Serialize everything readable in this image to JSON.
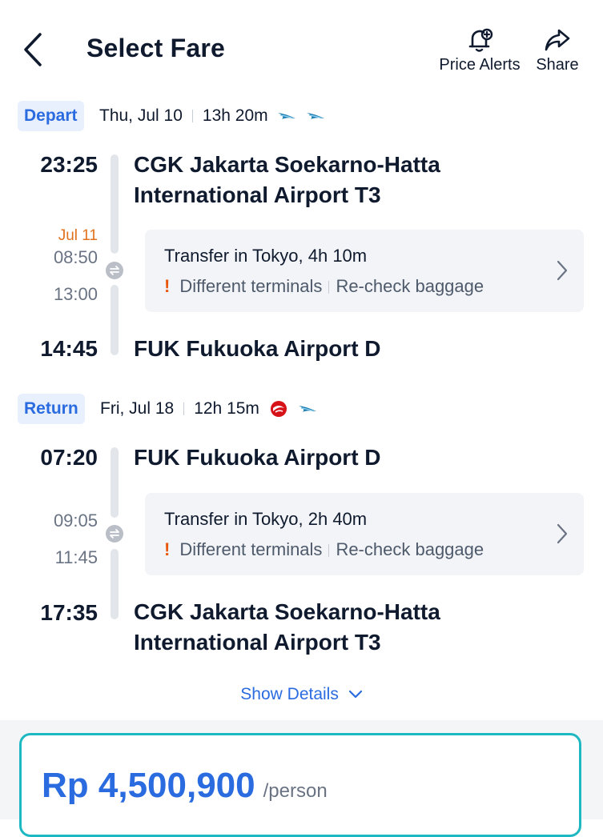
{
  "header": {
    "title": "Select Fare",
    "back_icon": "chevron-left-icon",
    "price_alerts_label": "Price Alerts",
    "share_label": "Share"
  },
  "depart": {
    "tag": "Depart",
    "date": "Thu, Jul 10",
    "duration": "13h 20m",
    "airlines": [
      "garuda-logo-icon",
      "garuda-logo-icon"
    ],
    "departure_time": "23:25",
    "departure_airport_line1": "CGK Jakarta Soekarno-Hatta",
    "departure_airport_line2": "International Airport T3",
    "transfer_date_note": "Jul 11",
    "transfer_arrive_time": "08:50",
    "transfer_depart_time": "13:00",
    "transfer_title": "Transfer in Tokyo, 4h 10m",
    "transfer_note1": "Different terminals",
    "transfer_note2": "Re-check baggage",
    "arrival_time": "14:45",
    "arrival_airport": "FUK Fukuoka Airport D"
  },
  "return": {
    "tag": "Return",
    "date": "Fri, Jul 18",
    "duration": "12h 15m",
    "airlines": [
      "jal-logo-icon",
      "garuda-logo-icon"
    ],
    "departure_time": "07:20",
    "departure_airport": "FUK Fukuoka Airport D",
    "transfer_arrive_time": "09:05",
    "transfer_depart_time": "11:45",
    "transfer_title": "Transfer in Tokyo, 2h 40m",
    "transfer_note1": "Different terminals",
    "transfer_note2": "Re-check baggage",
    "arrival_time": "17:35",
    "arrival_airport_line1": "CGK Jakarta Soekarno-Hatta",
    "arrival_airport_line2": "International Airport T3"
  },
  "show_details": "Show Details",
  "fare": {
    "price": "Rp 4,500,900",
    "unit": "/person"
  },
  "colors": {
    "accent": "#2a6be0",
    "warning": "#e8560c",
    "date_note": "#e2711d",
    "card_border": "#1db8c2"
  }
}
